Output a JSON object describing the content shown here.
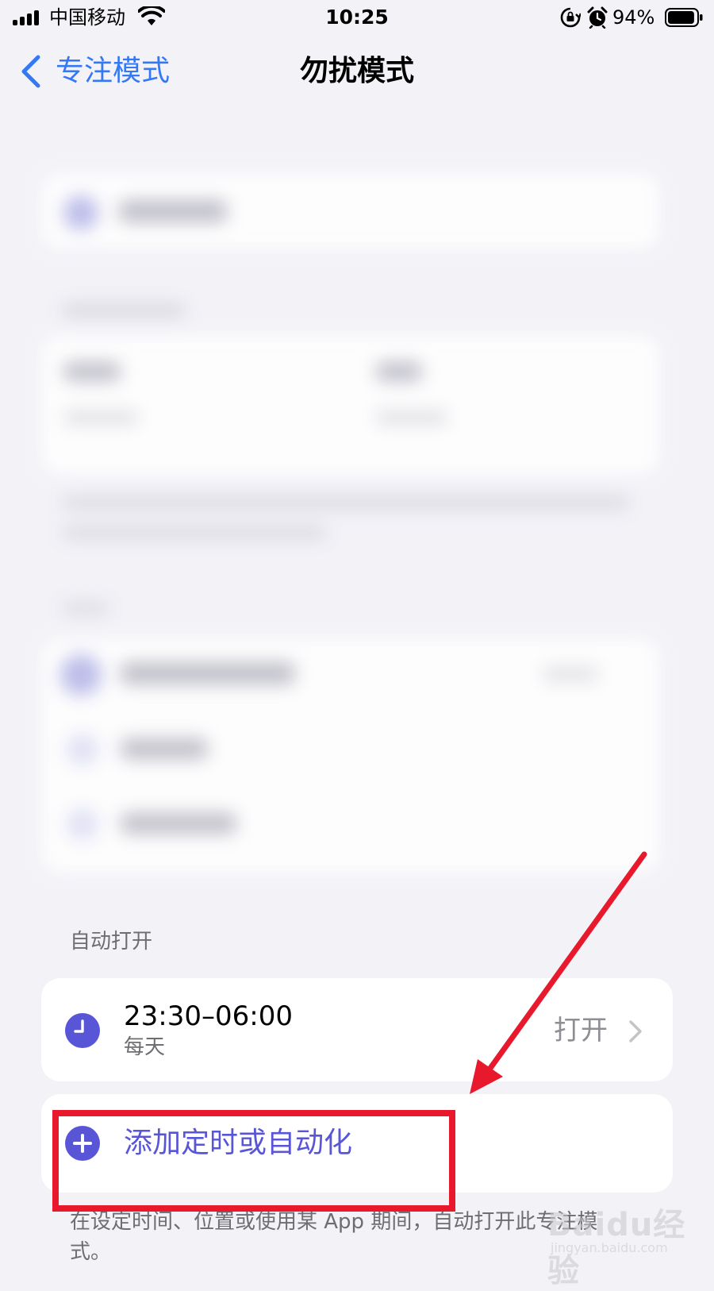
{
  "status_bar": {
    "carrier": "中国移动",
    "time": "10:25",
    "battery_percent": "94%",
    "battery_level": 0.94,
    "icons": [
      "signal-icon",
      "wifi-icon",
      "rotation-lock-icon",
      "alarm-icon",
      "battery-icon"
    ]
  },
  "nav": {
    "back_label": "专注模式",
    "title": "勿扰模式"
  },
  "automation": {
    "section_header": "自动打开",
    "schedule": {
      "time_range": "23:30–06:00",
      "days": "每天",
      "status": "打开"
    },
    "add_label": "添加定时或自动化",
    "footer_note": "在设定时间、位置或使用某 App 期间，自动打开此专注模式。"
  },
  "annotation": {
    "color": "#e8192c"
  },
  "watermark": {
    "brand": "Baidu经验",
    "url": "jingyan.baidu.com"
  },
  "colors": {
    "accent_blue": "#3478f6",
    "focus_purple": "#5856d6"
  }
}
